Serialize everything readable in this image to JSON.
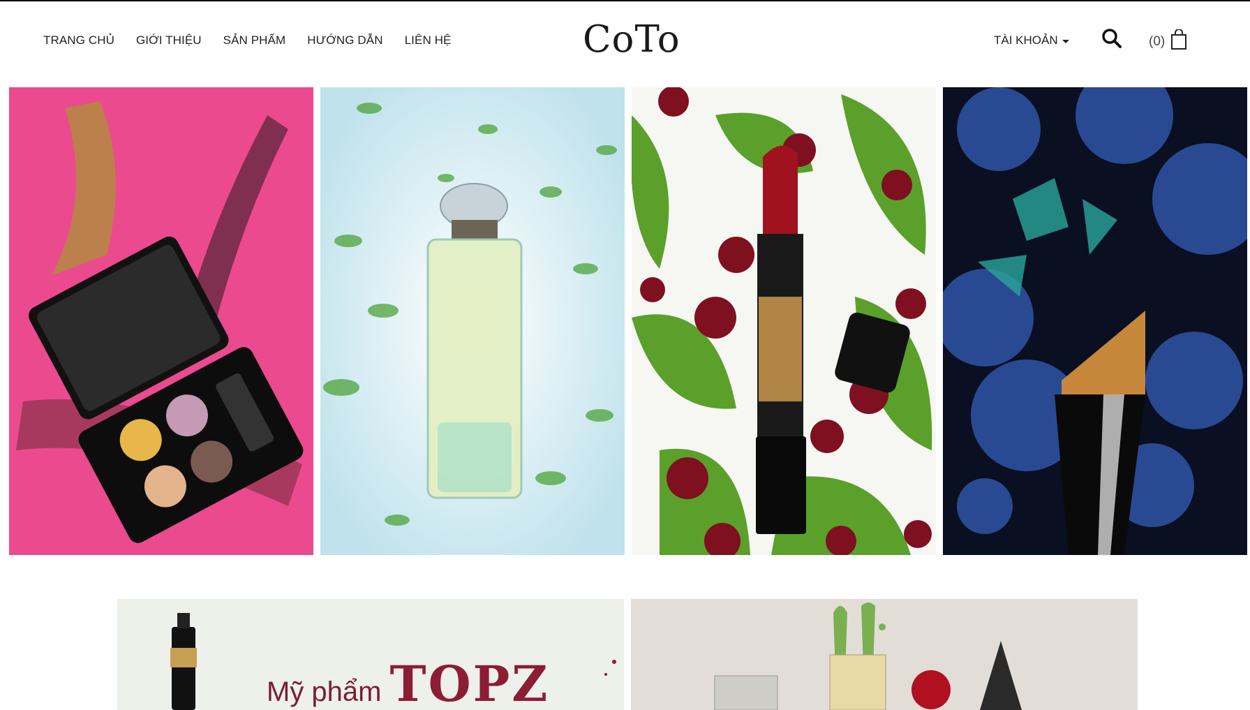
{
  "header": {
    "nav": [
      "TRANG CHỦ",
      "GIỚI THIỆU",
      "SẢN PHẨM",
      "HƯỚNG DẪN",
      "LIÊN HỆ"
    ],
    "logo": "CoTo",
    "account_label": "TÀI KHOẢN",
    "cart_count": "(0)"
  },
  "icons": [
    "search-icon",
    "shopping-bag-icon",
    "caret-down-icon"
  ],
  "tiles": [
    {
      "name": "eyeshadow-palette",
      "bg": "#ec4a8e"
    },
    {
      "name": "perfume-bottle",
      "bg": "#e9f2f4"
    },
    {
      "name": "red-lipstick",
      "bg": "#f6f6f2"
    },
    {
      "name": "makeup-brush",
      "bg": "#0a0f22"
    }
  ],
  "banners": {
    "left": {
      "lead": "Mỹ phẩm",
      "brand": "TOPZ"
    }
  }
}
